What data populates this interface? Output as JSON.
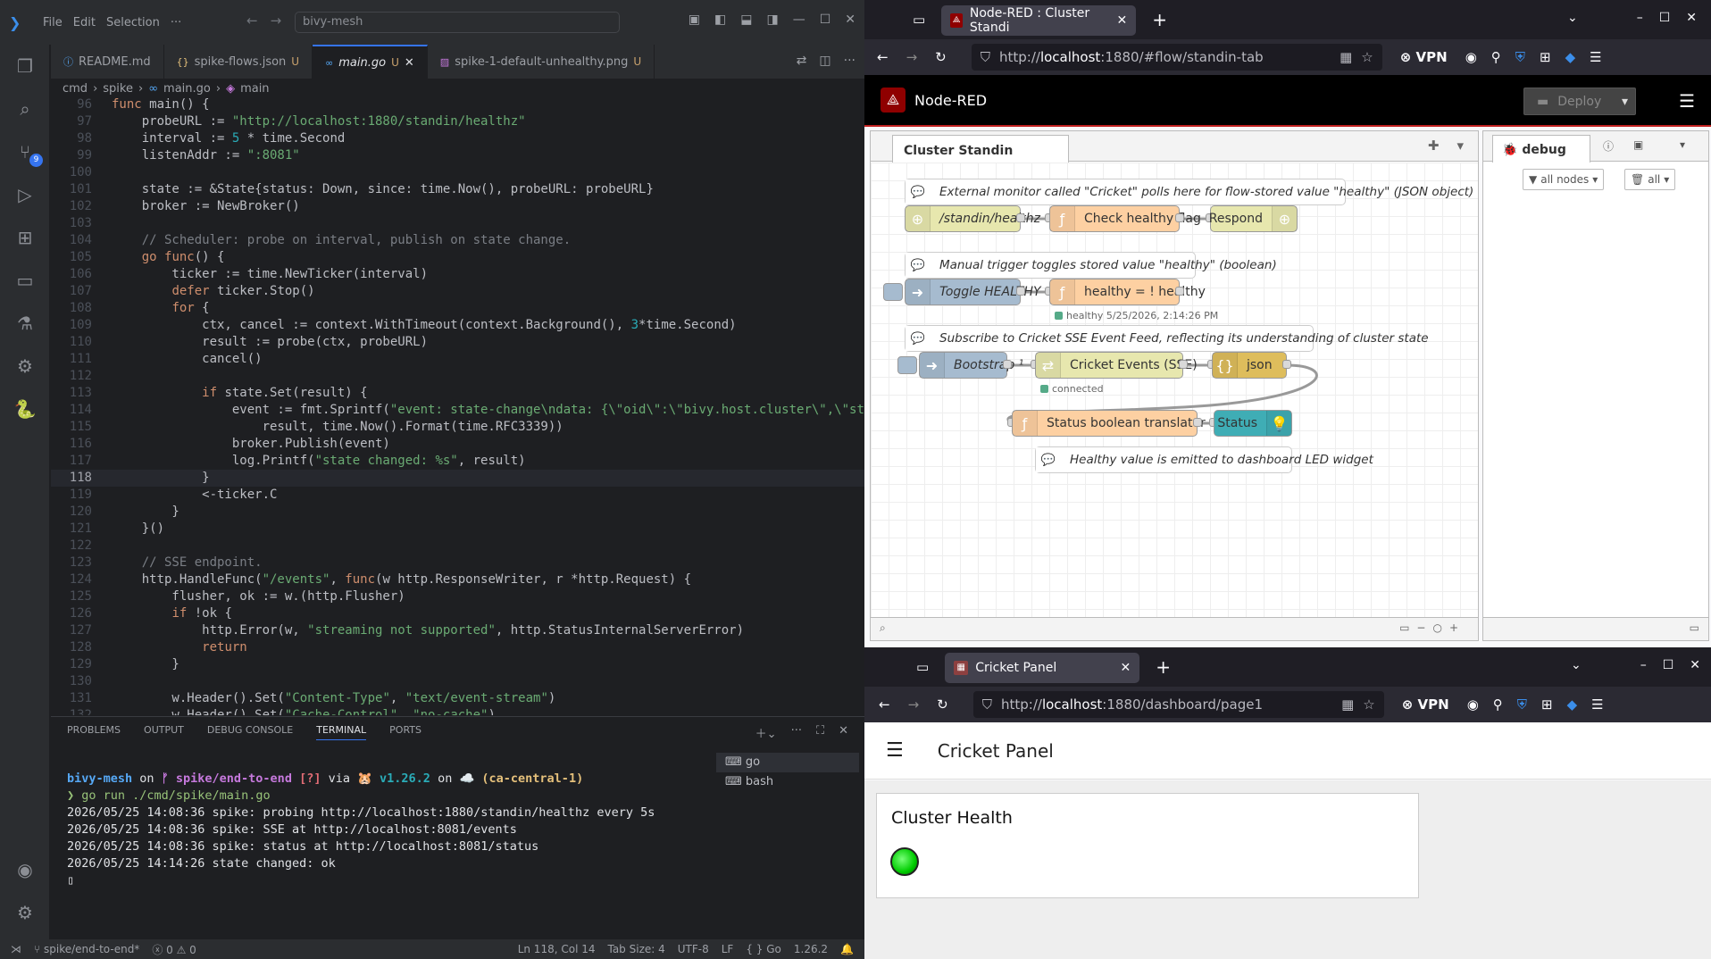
{
  "vscode": {
    "search": "bivy-mesh",
    "menu": [
      "File",
      "Edit",
      "Selection",
      "···"
    ],
    "tabs": [
      {
        "label": "README.md",
        "mod": ""
      },
      {
        "label": "spike-flows.json",
        "mod": "U"
      },
      {
        "label": "main.go",
        "mod": "U"
      },
      {
        "label": "spike-1-default-unhealthy.png",
        "mod": "U"
      }
    ],
    "breadcrumb": [
      "cmd",
      "spike",
      "main.go",
      "main"
    ],
    "code": [
      {
        "n": "96",
        "c": "func main() {"
      },
      {
        "n": "97",
        "c": "    probeURL := \"http://localhost:1880/standin/healthz\""
      },
      {
        "n": "98",
        "c": "    interval := 5 * time.Second"
      },
      {
        "n": "99",
        "c": "    listenAddr := \":8081\""
      },
      {
        "n": "100",
        "c": ""
      },
      {
        "n": "101",
        "c": "    state := &State{status: Down, since: time.Now(), probeURL: probeURL}"
      },
      {
        "n": "102",
        "c": "    broker := NewBroker()"
      },
      {
        "n": "103",
        "c": ""
      },
      {
        "n": "104",
        "c": "    // Scheduler: probe on interval, publish on state change."
      },
      {
        "n": "105",
        "c": "    go func() {"
      },
      {
        "n": "106",
        "c": "        ticker := time.NewTicker(interval)"
      },
      {
        "n": "107",
        "c": "        defer ticker.Stop()"
      },
      {
        "n": "108",
        "c": "        for {"
      },
      {
        "n": "109",
        "c": "            ctx, cancel := context.WithTimeout(context.Background(), 3*time.Second)"
      },
      {
        "n": "110",
        "c": "            result := probe(ctx, probeURL)"
      },
      {
        "n": "111",
        "c": "            cancel()"
      },
      {
        "n": "112",
        "c": ""
      },
      {
        "n": "113",
        "c": "            if state.Set(result) {"
      },
      {
        "n": "114",
        "c": "                event := fmt.Sprintf(\"event: state-change\\ndata: {\\\"oid\\\":\\\"bivy.host.cluster\\\",\\\"st"
      },
      {
        "n": "115",
        "c": "                    result, time.Now().Format(time.RFC3339))"
      },
      {
        "n": "116",
        "c": "                broker.Publish(event)"
      },
      {
        "n": "117",
        "c": "                log.Printf(\"state changed: %s\", result)"
      },
      {
        "n": "118",
        "c": "            }"
      },
      {
        "n": "119",
        "c": "            <-ticker.C"
      },
      {
        "n": "120",
        "c": "        }"
      },
      {
        "n": "121",
        "c": "    }()"
      },
      {
        "n": "122",
        "c": ""
      },
      {
        "n": "123",
        "c": "    // SSE endpoint."
      },
      {
        "n": "124",
        "c": "    http.HandleFunc(\"/events\", func(w http.ResponseWriter, r *http.Request) {"
      },
      {
        "n": "125",
        "c": "        flusher, ok := w.(http.Flusher)"
      },
      {
        "n": "126",
        "c": "        if !ok {"
      },
      {
        "n": "127",
        "c": "            http.Error(w, \"streaming not supported\", http.StatusInternalServerError)"
      },
      {
        "n": "128",
        "c": "            return"
      },
      {
        "n": "129",
        "c": "        }"
      },
      {
        "n": "130",
        "c": ""
      },
      {
        "n": "131",
        "c": "        w.Header().Set(\"Content-Type\", \"text/event-stream\")"
      },
      {
        "n": "132",
        "c": "        w.Header().Set(\"Cache-Control\", \"no-cache\")"
      }
    ],
    "current_line": "118",
    "panel_tabs": [
      "PROBLEMS",
      "OUTPUT",
      "DEBUG CONSOLE",
      "TERMINAL",
      "PORTS"
    ],
    "active_panel_tab": "TERMINAL",
    "prompt": {
      "dir": "bivy-mesh",
      "on1": " on ",
      "branch": "ᚠ spike/end-to-end",
      "dirty": " [?]",
      "via": " via ",
      "go": "🐹 v1.26.2",
      "on2": " on ",
      "cloud": "☁️ (ca-central-1)"
    },
    "command": "❯ go run ./cmd/spike/main.go",
    "terminal_lines": [
      "2026/05/25 14:08:36 spike: probing http://localhost:1880/standin/healthz every 5s",
      "2026/05/25 14:08:36 spike: SSE at http://localhost:8081/events",
      "2026/05/25 14:08:36 spike: status at http://localhost:8081/status",
      "2026/05/25 14:14:26 state changed: ok"
    ],
    "terminals": [
      "go",
      "bash"
    ],
    "status": {
      "branch": "spike/end-to-end*",
      "errors": "0",
      "warnings": "0",
      "position": "Ln 118, Col 14",
      "tab": "Tab Size: 4",
      "encoding": "UTF-8",
      "eol": "LF",
      "lang": "Go",
      "version": "1.26.2"
    }
  },
  "nodered": {
    "tab_title": "Node-RED : Cluster Standi",
    "url_host": "localhost",
    "url_pre": "http://",
    "url_post": ":1880/#flow/standin-tab",
    "vpn": "VPN",
    "app_title": "Node-RED",
    "deploy": "Deploy",
    "flow_tab": "Cluster Standin",
    "sidebar_tab": "debug",
    "filter_nodes": "all nodes",
    "filter_all": "all",
    "nodes": {
      "c1": "External monitor called \"Cricket\" polls here for flow-stored value \"healthy\" (JSON object)",
      "http_in": "/standin/healthz",
      "check": "Check healthy flag",
      "respond": "Respond",
      "c2": "Manual trigger toggles stored value \"healthy\" (boolean)",
      "toggle": "Toggle HEALTHY",
      "flip": "healthy = ! healthy",
      "flip_status": "healthy 5/25/2026, 2:14:26 PM",
      "c3": "Subscribe to Cricket SSE Event Feed, reflecting its understanding of cluster state",
      "bootstrap": "Bootstrap ¹",
      "sse": "Cricket Events (SSE)",
      "sse_status": "connected",
      "json": "json",
      "translator": "Status boolean translator",
      "status_node": "Status",
      "c4": "Healthy value is emitted to dashboard LED widget"
    }
  },
  "dashboard": {
    "tab_title": "Cricket Panel",
    "url_pre": "http://",
    "url_host": "localhost",
    "url_post": ":1880/dashboard/page1",
    "vpn": "VPN",
    "title": "Cricket Panel",
    "card_title": "Cluster Health",
    "led_color": "#00cc00",
    "healthy": true
  },
  "colors": {
    "accent": "#3574f0",
    "nodered_red": "#8f0000",
    "function_node": "#fdd0a2",
    "http_node": "#e7e7ae",
    "inject_node": "#a6bbcf",
    "json_node": "#debd5c",
    "ui_node": "#3fadb5"
  }
}
